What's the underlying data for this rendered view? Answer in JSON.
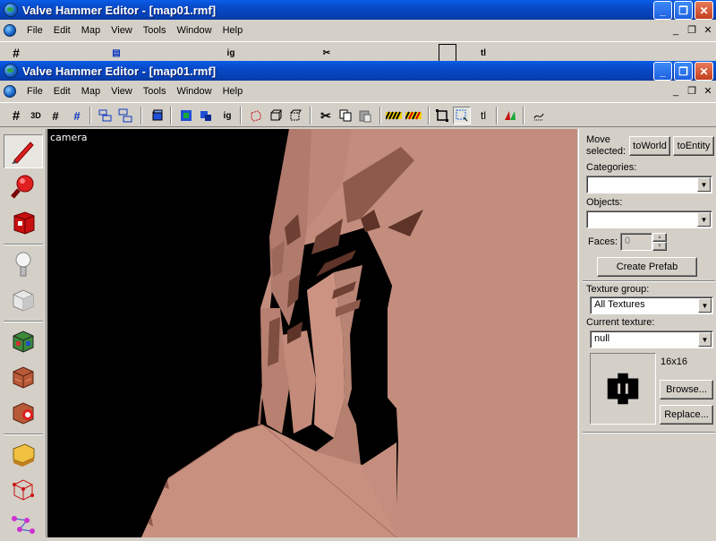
{
  "back_window": {
    "title": "Valve Hammer Editor - [map01.rmf]"
  },
  "window": {
    "title": "Valve Hammer Editor - [map01.rmf]",
    "controls": {
      "minimize": "_",
      "restore": "❐",
      "close": "✕"
    }
  },
  "menu": {
    "items": [
      {
        "label": "File"
      },
      {
        "label": "Edit"
      },
      {
        "label": "Map"
      },
      {
        "label": "View"
      },
      {
        "label": "Tools"
      },
      {
        "label": "Window"
      },
      {
        "label": "Help"
      }
    ],
    "mdi_controls": {
      "minimize": "_",
      "restore": "❐",
      "close": "✕"
    }
  },
  "toolbar": {
    "texture_lock_label": "ig",
    "text_label": "tl",
    "view_3d_label": "3D"
  },
  "viewport": {
    "label": "camera",
    "colors": {
      "background": "#000000",
      "wall": "#c38d7d"
    }
  },
  "right_panel": {
    "move_selected_label": "Move selected:",
    "to_world_button": "toWorld",
    "to_entity_button": "toEntity",
    "categories_label": "Categories:",
    "categories_value": "",
    "objects_label": "Objects:",
    "objects_value": "",
    "faces_label": "Faces:",
    "faces_value": "0",
    "create_prefab_button": "Create Prefab",
    "texture_group_label": "Texture group:",
    "texture_group_value": "All Textures",
    "current_texture_label": "Current texture:",
    "current_texture_value": "null",
    "texture_size": "16x16",
    "browse_button": "Browse...",
    "replace_button": "Replace..."
  }
}
